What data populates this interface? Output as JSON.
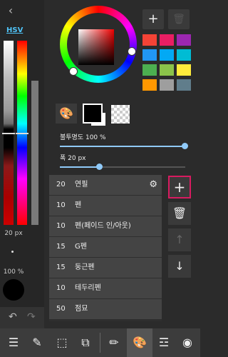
{
  "left_panel": {
    "back_icon": "chevron-left-icon",
    "mode_label": "HSV",
    "size_label": "20 px",
    "opacity_label": "100 %",
    "undo_icon": "undo-icon",
    "redo_icon": "redo-icon"
  },
  "color_picker": {
    "current_color": "#ff0000",
    "saturation": 1.0,
    "value": 0.0
  },
  "palette": {
    "add_icon": "plus-icon",
    "delete_icon": "trash-icon",
    "swatches": [
      "#f44336",
      "#e91e63",
      "#9c27b0",
      "#2196f3",
      "#03a9f4",
      "#00bcd4",
      "#4caf50",
      "#8bc34a",
      "#ffeb3b",
      "#ff9800",
      "#9e9e9e",
      "#607d8b"
    ]
  },
  "tool_row": {
    "palette_icon": "palette-icon",
    "foreground_color": "#000000",
    "background_color": "#ffffff"
  },
  "sliders": {
    "opacity_label": "불투명도 100 %",
    "opacity_value": 1.0,
    "width_label": "폭 20 px",
    "width_value": 0.3
  },
  "brushes": {
    "items": [
      {
        "size": "20",
        "name": "연필",
        "selected": true
      },
      {
        "size": "10",
        "name": "펜"
      },
      {
        "size": "10",
        "name": "펜(페이드 인/아웃)"
      },
      {
        "size": "15",
        "name": "G펜"
      },
      {
        "size": "15",
        "name": "둥근펜"
      },
      {
        "size": "10",
        "name": "테두리펜"
      },
      {
        "size": "50",
        "name": "점묘"
      }
    ],
    "settings_icon": "gear-icon",
    "add_icon": "plus-icon",
    "delete_icon": "trash-icon",
    "up_icon": "arrow-up-icon",
    "down_icon": "arrow-down-icon"
  },
  "toolbar": {
    "icons": [
      "menu-icon",
      "edit-icon",
      "selection-icon",
      "transform-icon",
      "pen-icon",
      "palette-icon",
      "layers-icon",
      "settings-icon"
    ]
  }
}
